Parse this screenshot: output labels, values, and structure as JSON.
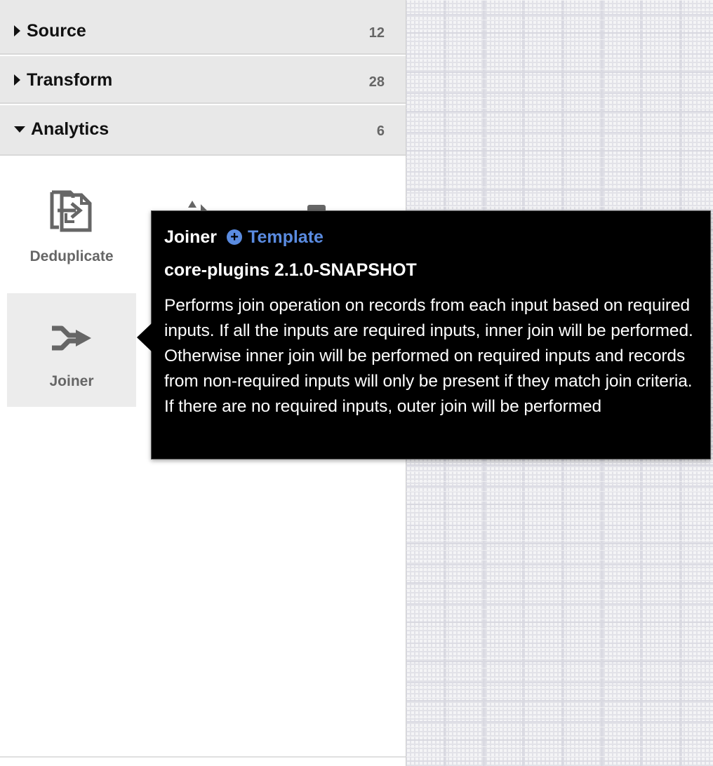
{
  "sidebar": {
    "groups": [
      {
        "label": "Source",
        "count": "12",
        "expanded": false
      },
      {
        "label": "Transform",
        "count": "28",
        "expanded": false
      },
      {
        "label": "Analytics",
        "count": "6",
        "expanded": true
      }
    ],
    "plugins": [
      {
        "label": "Deduplicate",
        "icon": "deduplicate-icon"
      },
      {
        "label": "",
        "icon": "distinct-icon"
      },
      {
        "label": "",
        "icon": "group-by-icon"
      },
      {
        "label": "Joiner",
        "icon": "joiner-icon",
        "selected": true
      }
    ]
  },
  "tooltip": {
    "name": "Joiner",
    "template_label": "Template",
    "artifact": "core-plugins 2.1.0-SNAPSHOT",
    "description": "Performs join operation on records from each input based on required inputs. If all the inputs are required inputs, inner join will be performed. Otherwise inner join will be performed on required inputs and records from non-required inputs will only be present if they match join criteria. If there are no required inputs, outer join will be performed"
  },
  "colors": {
    "group_header_bg": "#e8e8e8",
    "tooltip_bg": "#000000",
    "template_link": "#5a8be0",
    "icon_gray": "#666666",
    "canvas_bg": "#f4f4f6"
  }
}
